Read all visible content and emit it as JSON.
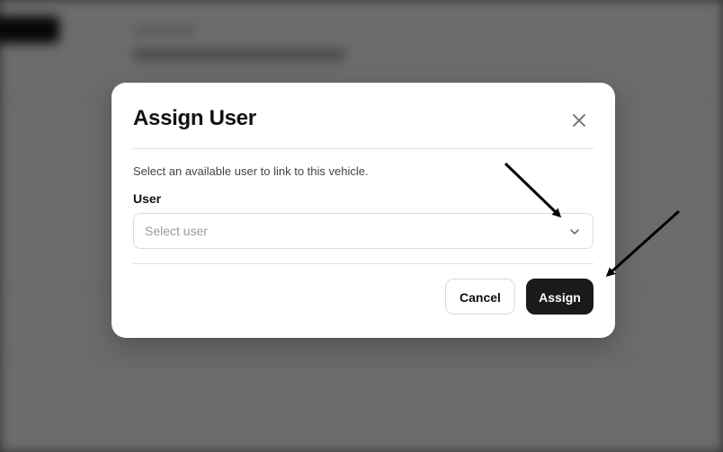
{
  "dialog": {
    "title": "Assign User",
    "description": "Select an available user to link to this vehicle.",
    "field_label": "User",
    "select_placeholder": "Select user",
    "cancel_label": "Cancel",
    "assign_label": "Assign",
    "close_icon": "close-icon",
    "chevron_icon": "chevron-down-icon"
  },
  "colors": {
    "primary_button": "#1a1a1a",
    "overlay": "#000000",
    "annotation_arrow": "#000000"
  }
}
